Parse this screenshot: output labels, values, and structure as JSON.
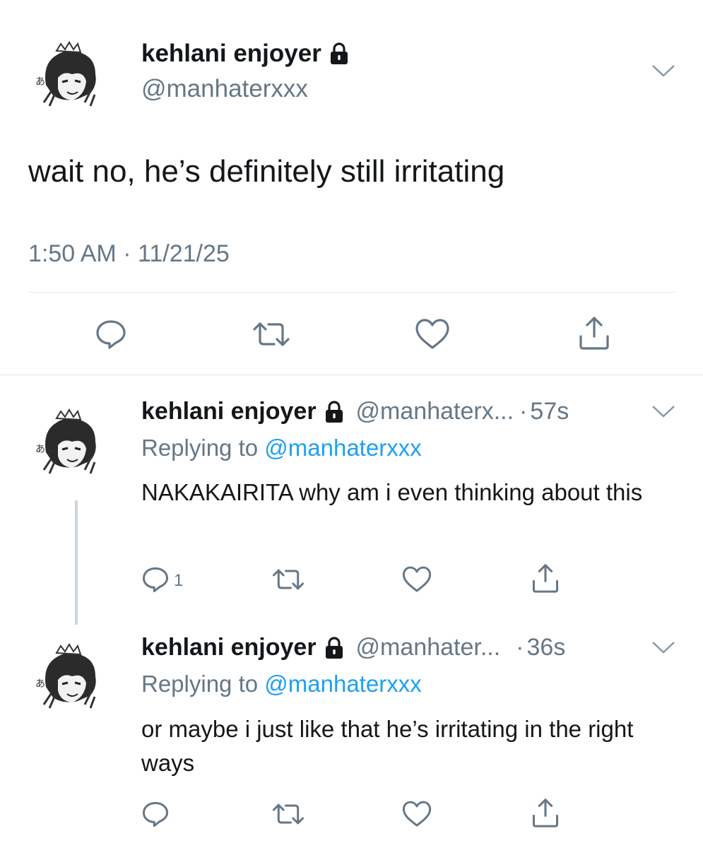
{
  "main_tweet": {
    "display_name": "kehlani enjoyer",
    "handle": "@manhaterxxx",
    "text": "wait no, he’s definitely still irritating",
    "timestamp": "1:50 AM · 11/21/25"
  },
  "replies": [
    {
      "display_name": "kehlani enjoyer",
      "handle": "@manhaterx...",
      "time": "57s",
      "replying_prefix": "Replying to",
      "replying_to": "@manhaterxxx",
      "text": "NAKAKAIRITA why am i even thinking about this",
      "reply_count": "1"
    },
    {
      "display_name": "kehlani enjoyer",
      "handle": "@manhater...",
      "time": "36s",
      "replying_prefix": "Replying to",
      "replying_to": "@manhaterxxx",
      "text": "or maybe i just like that he’s irritating in the right ways",
      "reply_count": ""
    }
  ],
  "icons": {
    "reply": "reply-icon",
    "retweet": "retweet-icon",
    "like": "heart-icon",
    "share": "share-icon",
    "lock": "lock-icon",
    "more": "chevron-down-icon"
  },
  "colors": {
    "text": "#14171a",
    "secondary": "#657786",
    "link": "#1da1f2",
    "divider": "#e1e8ed"
  }
}
